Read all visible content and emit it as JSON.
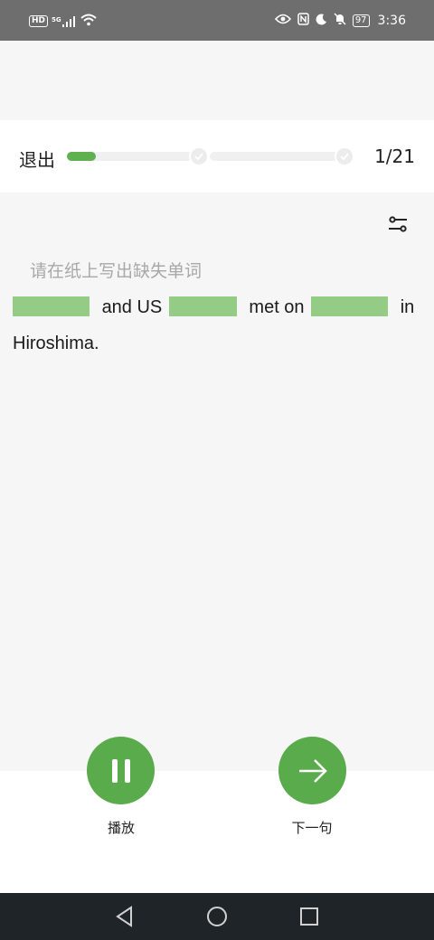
{
  "status_bar": {
    "hd": "HD",
    "network": "5G",
    "battery": "97",
    "time": "3:36"
  },
  "header": {
    "exit_label": "退出",
    "progress": {
      "current": 1,
      "total": 21
    },
    "page_count": "1/21"
  },
  "content": {
    "instruction": "请在纸上写出缺失单词",
    "sentence": {
      "part1": "and US",
      "part2": "met on",
      "part3": "in",
      "part4": "Hiroshima."
    }
  },
  "controls": {
    "play_label": "播放",
    "next_label": "下一句"
  },
  "colors": {
    "accent": "#5aab4b",
    "blank": "#94cb85",
    "status_bar": "#6e6e6e",
    "nav_bar": "#1f2429"
  },
  "icons": [
    "hd-icon",
    "signal-icon",
    "wifi-icon",
    "eye-icon",
    "nfc-icon",
    "moon-icon",
    "bell-off-icon",
    "battery-icon",
    "check-icon",
    "settings-sliders-icon",
    "pause-icon",
    "arrow-right-icon",
    "back-triangle-icon",
    "home-circle-icon",
    "recents-square-icon"
  ]
}
